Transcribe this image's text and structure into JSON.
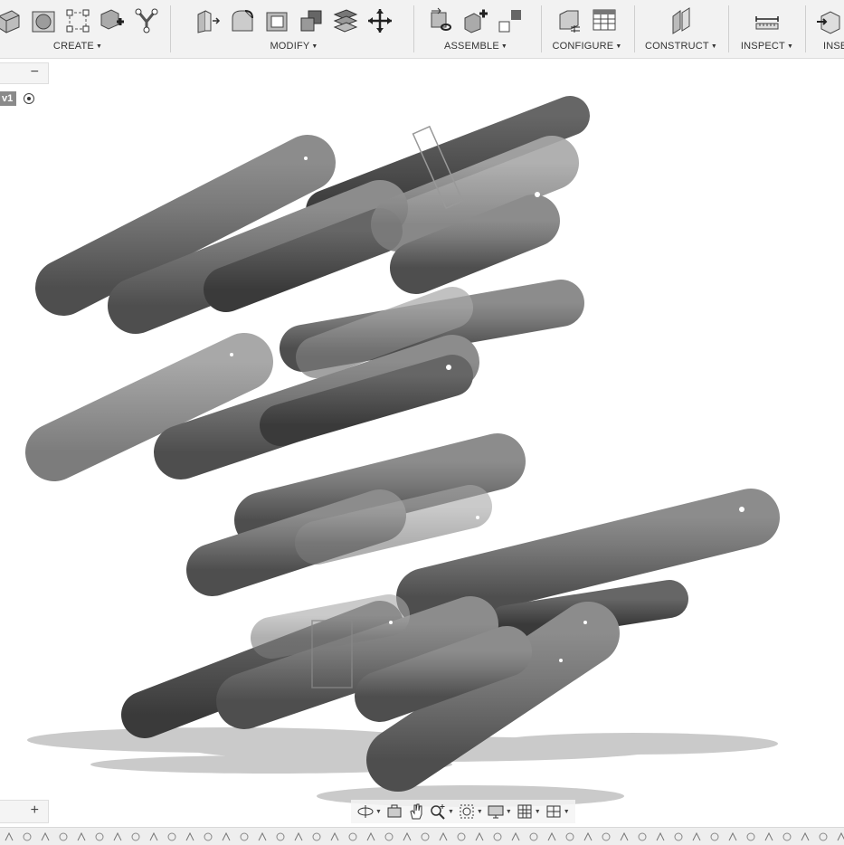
{
  "toolbar": {
    "groups": [
      {
        "label": "CREATE",
        "icons": [
          "box-icon",
          "cylinder-icon",
          "sketch-icon",
          "combine-plus-icon",
          "form-icon"
        ]
      },
      {
        "label": "MODIFY",
        "icons": [
          "press-pull-icon",
          "fillet-icon",
          "shell-icon",
          "combine-icon",
          "split-body-icon",
          "move-copy-icon"
        ]
      },
      {
        "label": "ASSEMBLE",
        "icons": [
          "joint-icon",
          "new-component-icon",
          "as-built-joint-icon"
        ]
      },
      {
        "label": "CONFIGURE",
        "icons": [
          "configure-icon",
          "configuration-table-icon"
        ]
      },
      {
        "label": "CONSTRUCT",
        "icons": [
          "offset-plane-icon"
        ]
      },
      {
        "label": "INSPECT",
        "icons": [
          "measure-icon"
        ]
      },
      {
        "label": "INSE",
        "icons": [
          "insert-icon"
        ]
      }
    ]
  },
  "browser": {
    "collapse_symbol": "−",
    "version_label": "v1"
  },
  "comments": {
    "add_symbol": "+"
  },
  "navbar": {
    "buttons": [
      "orbit-icon",
      "look-at-icon",
      "pan-icon",
      "zoom-icon",
      "fit-icon",
      "display-settings-icon",
      "grid-icon",
      "viewports-icon"
    ]
  },
  "colors": {
    "toolbar_bg": "#f2f2f2",
    "viewport_bg": "#ffffff",
    "model": "#6e6e6e"
  }
}
